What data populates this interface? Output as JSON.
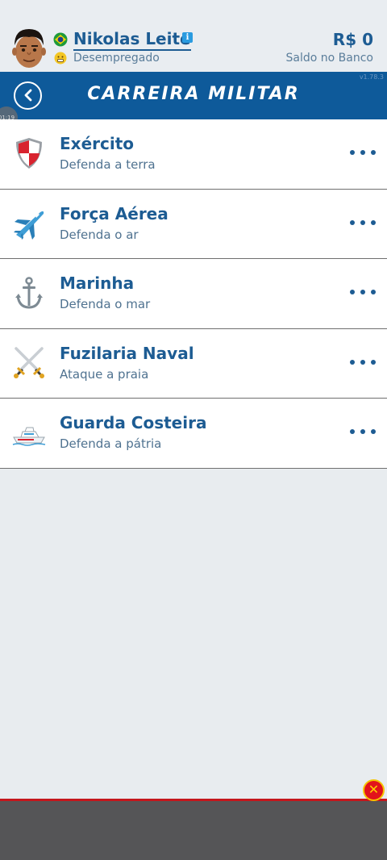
{
  "header": {
    "player_name": "Nikolas Leite",
    "status": "Desempregado",
    "balance": "R$ 0",
    "balance_label": "Saldo no Banco",
    "flag_icon": "brazil-flag-icon",
    "mood_icon": "smiley-face-icon"
  },
  "titlebar": {
    "title": "CARREIRA MILITAR",
    "version": "v1.78.3",
    "background": "#0e5a9a"
  },
  "timer": "01:19",
  "careers": [
    {
      "title": "Exército",
      "subtitle": "Defenda a terra",
      "icon": "shield-icon"
    },
    {
      "title": "Força Aérea",
      "subtitle": "Defenda o ar",
      "icon": "airplane-icon"
    },
    {
      "title": "Marinha",
      "subtitle": "Defenda o mar",
      "icon": "anchor-icon"
    },
    {
      "title": "Fuzilaria Naval",
      "subtitle": "Ataque a praia",
      "icon": "crossed-swords-icon"
    },
    {
      "title": "Guarda Costeira",
      "subtitle": "Defenda a pátria",
      "icon": "ship-icon"
    }
  ],
  "colors": {
    "accent": "#1d5c93",
    "ad_border": "#c4161c"
  }
}
